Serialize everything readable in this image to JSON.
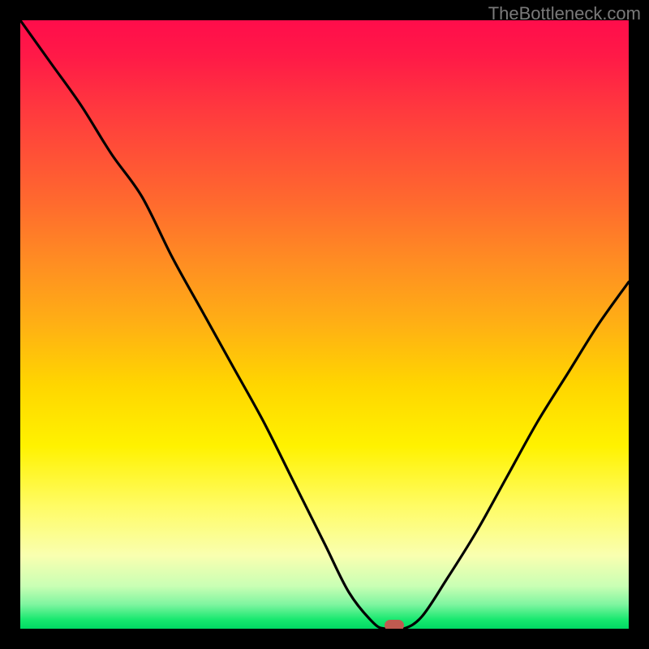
{
  "watermark": "TheBottleneck.com",
  "chart_data": {
    "type": "line",
    "title": "",
    "xlabel": "",
    "ylabel": "",
    "xlim": [
      0,
      100
    ],
    "ylim": [
      0,
      100
    ],
    "grid": false,
    "legend": false,
    "series": [
      {
        "name": "curve",
        "x": [
          0,
          5,
          10,
          15,
          20,
          25,
          30,
          35,
          40,
          45,
          50,
          54,
          58,
          60,
          63,
          66,
          70,
          75,
          80,
          85,
          90,
          95,
          100
        ],
        "values": [
          100,
          93,
          86,
          78,
          71,
          61,
          52,
          43,
          34,
          24,
          14,
          6,
          1,
          0,
          0,
          2,
          8,
          16,
          25,
          34,
          42,
          50,
          57
        ]
      }
    ],
    "marker": {
      "x": 61.5,
      "y": 0.5
    },
    "gradient_stops": [
      {
        "pos": 0,
        "color": "#ff0d4b"
      },
      {
        "pos": 0.3,
        "color": "#ff6a2e"
      },
      {
        "pos": 0.6,
        "color": "#ffd600"
      },
      {
        "pos": 0.88,
        "color": "#f9ffb0"
      },
      {
        "pos": 1.0,
        "color": "#00d964"
      }
    ]
  }
}
